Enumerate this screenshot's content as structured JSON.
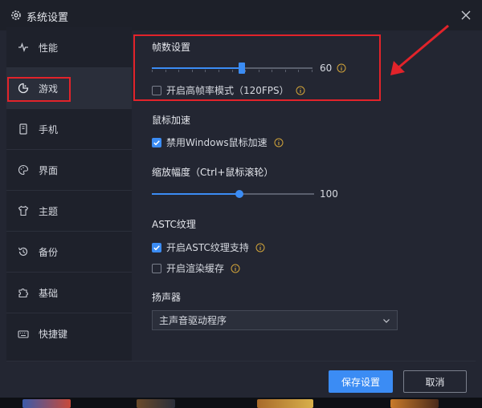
{
  "window": {
    "title": "系统设置"
  },
  "sidebar": {
    "items": [
      {
        "label": "性能",
        "icon": "pulse-icon"
      },
      {
        "label": "游戏",
        "icon": "game-icon",
        "active": true
      },
      {
        "label": "手机",
        "icon": "phone-icon"
      },
      {
        "label": "界面",
        "icon": "palette-icon"
      },
      {
        "label": "主题",
        "icon": "shirt-icon"
      },
      {
        "label": "备份",
        "icon": "backup-icon"
      },
      {
        "label": "基础",
        "icon": "puzzle-icon"
      },
      {
        "label": "快捷键",
        "icon": "keyboard-icon"
      }
    ]
  },
  "fps": {
    "title": "帧数设置",
    "value": 60,
    "value_label": "60",
    "max": 120,
    "high_fps_label": "开启高帧率模式（120FPS）",
    "high_fps_checked": false
  },
  "mouse": {
    "title": "鼠标加速",
    "disable_accel_label": "禁用Windows鼠标加速",
    "disable_accel_checked": true
  },
  "zoom": {
    "title": "缩放幅度（Ctrl+鼠标滚轮）",
    "value": 100,
    "value_label": "100",
    "fraction": 0.5
  },
  "astc": {
    "title": "ASTC纹理",
    "enable_label": "开启ASTC纹理支持",
    "enable_checked": true,
    "cache_label": "开启渲染缓存",
    "cache_checked": false
  },
  "speaker": {
    "title": "扬声器",
    "selected": "主声音驱动程序"
  },
  "footer": {
    "save_label": "保存设置",
    "cancel_label": "取消"
  },
  "colors": {
    "accent": "#3b8cf4",
    "annotation": "#e2232a",
    "dialog_bg": "#232632",
    "sidebar_bg": "#1e212b"
  }
}
